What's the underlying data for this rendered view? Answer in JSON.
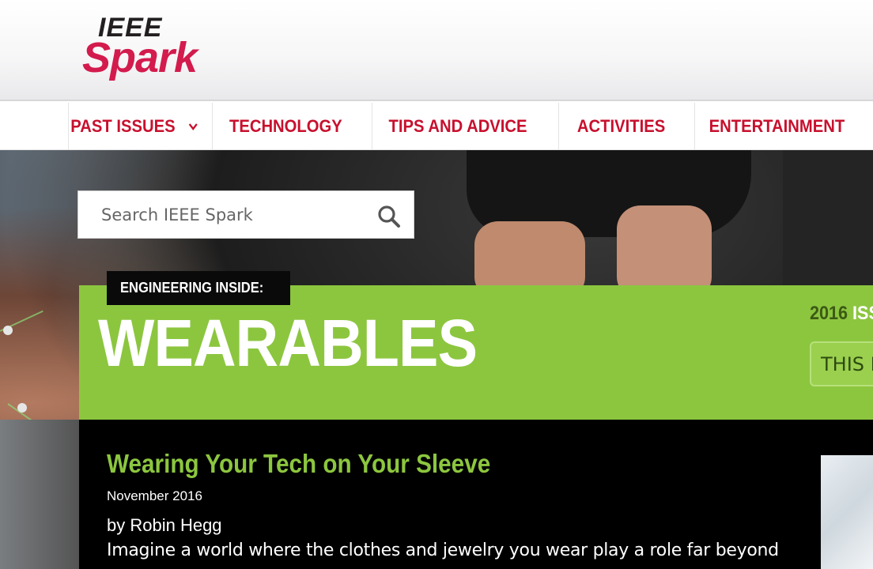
{
  "logo": {
    "top": "IEEE",
    "bottom": "Spark"
  },
  "nav": {
    "items": [
      {
        "label": "PAST ISSUES"
      },
      {
        "label": "TECHNOLOGY"
      },
      {
        "label": "TIPS AND ADVICE"
      },
      {
        "label": "ACTIVITIES"
      },
      {
        "label": "ENTERTAINMENT"
      }
    ]
  },
  "search": {
    "placeholder": "Search IEEE Spark"
  },
  "section": {
    "eyebrow": "ENGINEERING INSIDE:",
    "title": "WEARABLES",
    "year": "2016",
    "issue_word": "ISS",
    "issue_button": "THIS IS"
  },
  "article": {
    "title": "Wearing Your Tech on Your Sleeve",
    "date": "November 2016",
    "author": "by Robin Hegg",
    "body_line1": "Imagine a world where the clothes and jewelry you wear play a role far beyond"
  },
  "colors": {
    "brand_red": "#c8102e",
    "logo_pink": "#d31b4d",
    "accent_green": "#8cc63f"
  },
  "icons": {
    "search": "search-icon",
    "chevron": "chevron-down-icon"
  }
}
